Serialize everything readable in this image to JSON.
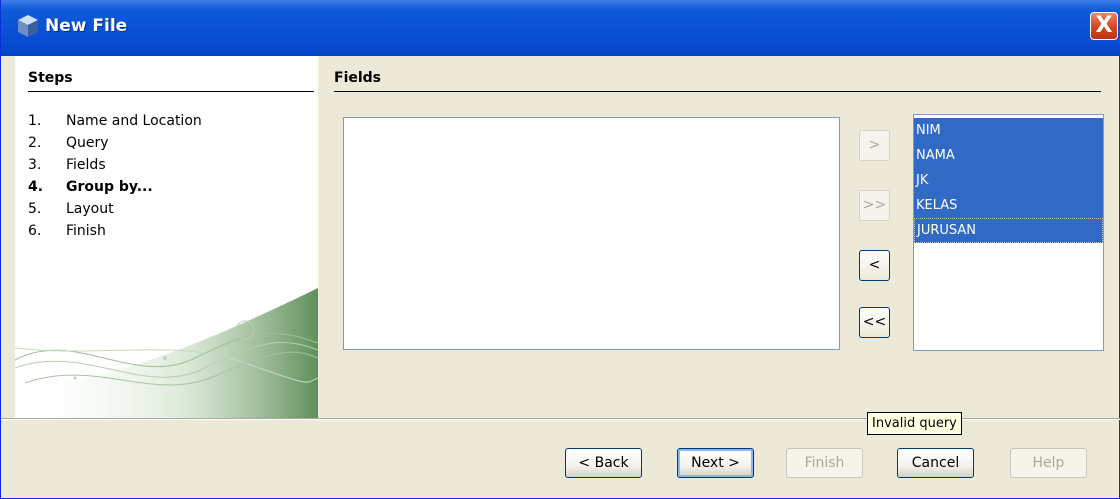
{
  "window": {
    "title": "New File",
    "close_glyph": "X"
  },
  "steps": {
    "title": "Steps",
    "items": [
      {
        "num": "1.",
        "label": "Name and Location",
        "active": false
      },
      {
        "num": "2.",
        "label": "Query",
        "active": false
      },
      {
        "num": "3.",
        "label": "Fields",
        "active": false
      },
      {
        "num": "4.",
        "label": "Group by...",
        "active": true
      },
      {
        "num": "5.",
        "label": "Layout",
        "active": false
      },
      {
        "num": "6.",
        "label": "Finish",
        "active": false
      }
    ]
  },
  "fields": {
    "title": "Fields",
    "available_fields": [],
    "move_buttons": {
      "add_one": ">",
      "add_all": ">>",
      "remove_one": "<",
      "remove_all": "<<"
    },
    "selected_fields": [
      "NIM",
      "NAMA",
      "JK",
      "KELAS",
      "JURUSAN"
    ]
  },
  "tooltip": "Invalid query",
  "buttons": {
    "back": "< Back",
    "next": "Next >",
    "finish": "Finish",
    "cancel": "Cancel",
    "help": "Help"
  },
  "colors": {
    "selection": "#316ac5",
    "titlebar": "#0a4fd6",
    "panel": "#ece9d8"
  }
}
